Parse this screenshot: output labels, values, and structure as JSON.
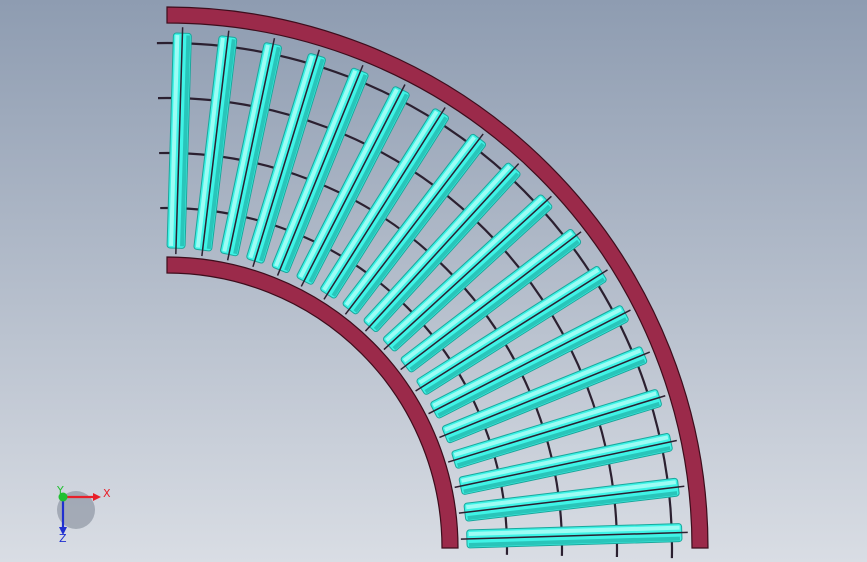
{
  "viewport": {
    "background_top": "#8e9cb1",
    "background_bottom": "#d9dde4"
  },
  "model": {
    "frame_color": "#9b2a4a",
    "frame_edge_color": "#3d0d1c",
    "roller_color": "#3ff3e6",
    "roller_shadow_color": "#1aa79c",
    "roller_highlight_color": "#c4fffa",
    "shaft_color": "#2b2030",
    "roller_count": 18,
    "support_rails": 4,
    "sweep_degrees": 90
  },
  "triad": {
    "x_label": "X",
    "y_label": "Y",
    "z_label": "Z",
    "x_color": "#e8202a",
    "y_color": "#20c030",
    "z_color": "#2030d0"
  }
}
